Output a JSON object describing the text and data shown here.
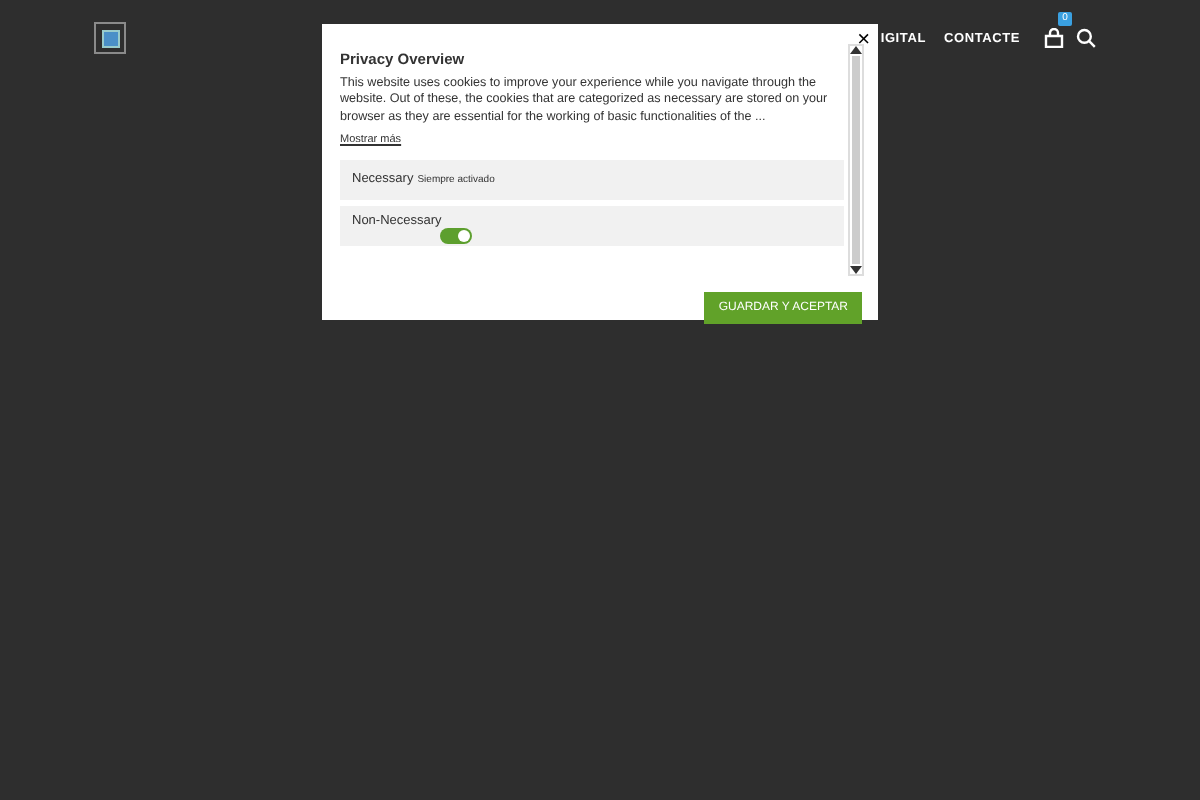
{
  "header": {
    "nav": [
      {
        "label": "IGITAL"
      },
      {
        "label": "CONTACTE"
      }
    ],
    "cart_badge": "0"
  },
  "modal": {
    "close": "×",
    "title": "Privacy Overview",
    "text": "This website uses cookies to improve your experience while you navigate through the website. Out of these, the cookies that are categorized as necessary are stored on your browser as they are essential for the working of basic functionalities of the ...",
    "more": "Mostrar más",
    "categories": [
      {
        "kind": "fixed",
        "name": "Necessary",
        "note": "Siempre activado"
      },
      {
        "kind": "toggle",
        "name": "Non-Necessary",
        "on": true
      }
    ],
    "button": "GUARDAR Y ACEPTAR"
  }
}
